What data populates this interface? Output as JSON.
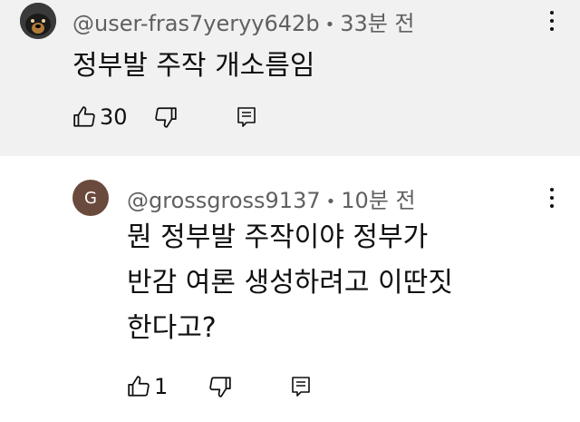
{
  "comments": [
    {
      "username": "@user-fras7yeryy642b",
      "time": "33분 전",
      "text_lines": [
        "정부발 주작 개소름임"
      ],
      "likes": "30"
    },
    {
      "avatar_letter": "G",
      "username": "@grossgross9137",
      "time": "10분 전",
      "text_lines": [
        "뭔 정부발 주작이야 정부가",
        "반감 여론 생성하려고 이딴짓",
        "한다고?"
      ],
      "likes": "1"
    }
  ],
  "icons": [
    "thumbs-up-icon",
    "thumbs-down-icon",
    "reply-icon",
    "more-vert-icon"
  ],
  "colors": {
    "top_bg": "#f1f1f1",
    "meta_text": "#606060",
    "avatar_g": "#6a4a3c"
  }
}
